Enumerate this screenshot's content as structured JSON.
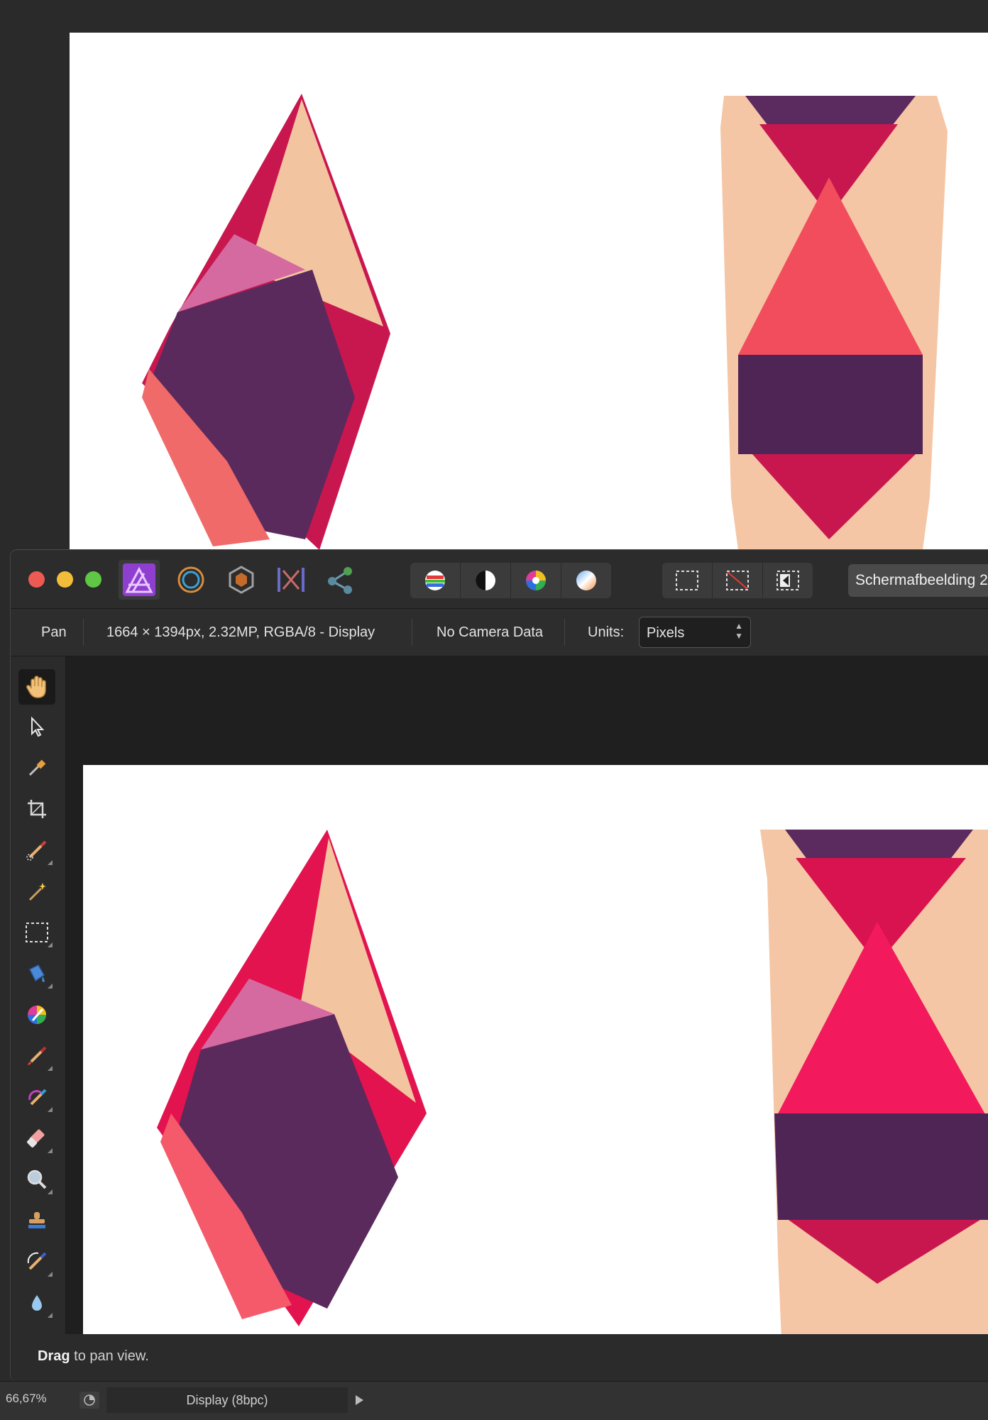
{
  "window": {
    "document_tab": "Schermafbeelding 2"
  },
  "context_bar": {
    "tool_name": "Pan",
    "image_info": "1664 × 1394px, 2.32MP, RGBA/8 - Display",
    "camera_info": "No Camera Data",
    "units_label": "Units:",
    "units_value": "Pixels"
  },
  "personas": [
    "photo-persona-icon",
    "liquify-persona-icon",
    "develop-persona-icon",
    "tone-mapping-persona-icon",
    "export-persona-icon"
  ],
  "toolbar": {
    "tools": [
      "view-tool",
      "move-tool",
      "color-picker-tool",
      "crop-tool",
      "selection-brush-tool",
      "flood-select-tool",
      "rectangular-marquee-tool",
      "flood-fill-tool",
      "color-replace-tool",
      "paint-brush-tool",
      "paint-mixer-brush-tool",
      "erase-brush-tool",
      "dodge-brush-tool",
      "clone-brush-tool",
      "inpainting-brush-tool",
      "blur-brush-tool",
      "smudge-brush-tool"
    ]
  },
  "hint": {
    "action": "Drag",
    "rest": "to pan view."
  },
  "status": {
    "zoom": "66,67%",
    "display_mode": "Display (8bpc)"
  },
  "colors": {
    "accent": "#a14fd6",
    "close": "#ed5a54",
    "minimize": "#f4bd39",
    "maximize": "#5fc745"
  }
}
